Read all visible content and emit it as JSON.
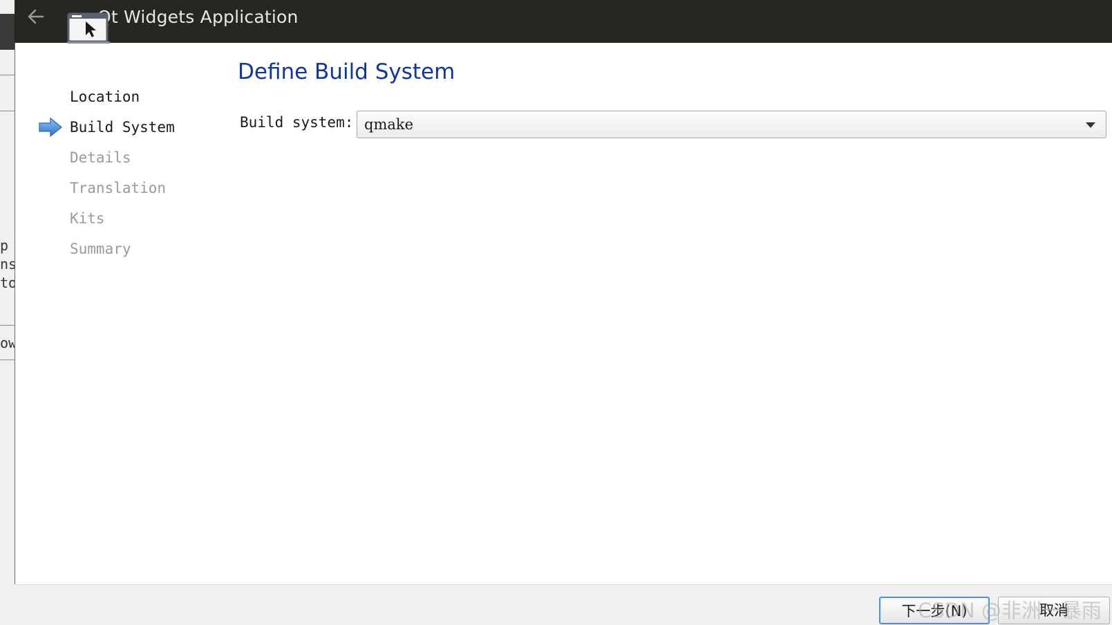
{
  "window": {
    "title": "Qt Widgets Application"
  },
  "background_fragments": [
    "p",
    "ns",
    "to",
    "ow"
  ],
  "steps": [
    {
      "label": "Location",
      "state": "done"
    },
    {
      "label": "Build System",
      "state": "current"
    },
    {
      "label": "Details",
      "state": "pending"
    },
    {
      "label": "Translation",
      "state": "pending"
    },
    {
      "label": "Kits",
      "state": "pending"
    },
    {
      "label": "Summary",
      "state": "pending"
    }
  ],
  "page": {
    "title": "Define Build System",
    "build_system_label": "Build system:",
    "build_system_value": "qmake"
  },
  "buttons": {
    "next": "下一步(N)",
    "cancel": "取消"
  },
  "watermark": "CSDN @非洲一暴雨",
  "icons": {
    "back": "back-arrow-icon",
    "app": "application-window-icon",
    "current_step": "current-step-arrow-icon",
    "dropdown": "chevron-down-icon"
  },
  "colors": {
    "title_bar": "#262622",
    "page_title": "#10369a",
    "step_arrow": "#4a8ee0",
    "next_button_border": "#4a90d9"
  }
}
